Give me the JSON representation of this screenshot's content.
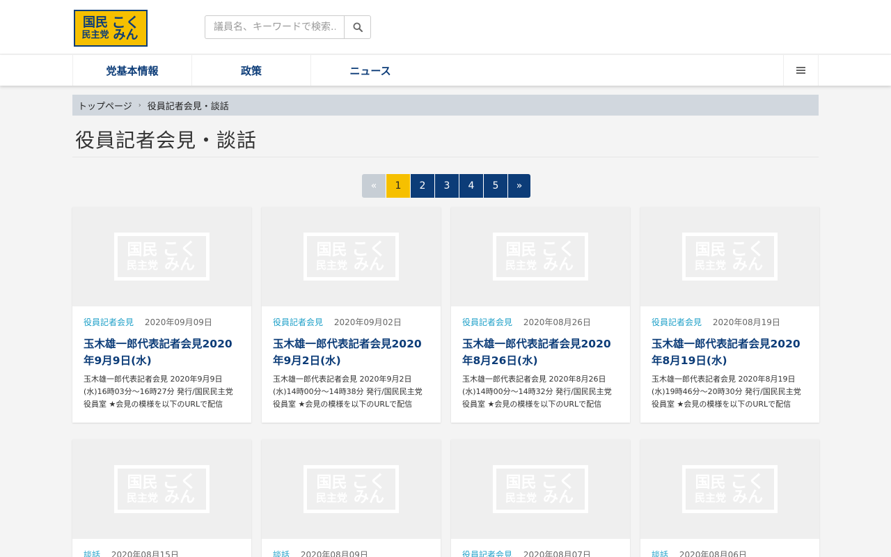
{
  "header": {
    "logo": {
      "kanji_top": "国民",
      "kanji_bottom": "民主党",
      "hira_top": "こく",
      "hira_bottom": "みん"
    },
    "search": {
      "placeholder": "議員名、キーワードで検索.."
    }
  },
  "nav": {
    "items": [
      {
        "label": "党基本情報"
      },
      {
        "label": "政策"
      },
      {
        "label": "ニュース"
      }
    ],
    "menu_icon": "hamburger-icon"
  },
  "breadcrumb": {
    "home": "トップページ",
    "separator": "›",
    "current": "役員記者会見・談話"
  },
  "page": {
    "title": "役員記者会見・談話"
  },
  "pagination": {
    "prev": "«",
    "pages": [
      "1",
      "2",
      "3",
      "4",
      "5"
    ],
    "active": "1",
    "next": "»"
  },
  "cards": [
    {
      "category": "役員記者会見",
      "date": "2020年09月09日",
      "title": "玉木雄一郎代表記者会見2020年9月9日(水)",
      "excerpt": "玉木雄一郎代表記者会見 2020年9月9日(水)16時03分〜16時27分 発行/国民民主党役員室 ★会見の模様を以下のURLで配信"
    },
    {
      "category": "役員記者会見",
      "date": "2020年09月02日",
      "title": "玉木雄一郎代表記者会見2020年9月2日(水)",
      "excerpt": "玉木雄一郎代表記者会見 2020年9月2日(水)14時00分〜14時38分 発行/国民民主党役員室 ★会見の模様を以下のURLで配信"
    },
    {
      "category": "役員記者会見",
      "date": "2020年08月26日",
      "title": "玉木雄一郎代表記者会見2020年8月26日(水)",
      "excerpt": "玉木雄一郎代表記者会見 2020年8月26日(水)14時00分〜14時32分 発行/国民民主党役員室 ★会見の模様を以下のURLで配信"
    },
    {
      "category": "役員記者会見",
      "date": "2020年08月19日",
      "title": "玉木雄一郎代表記者会見2020年8月19日(水)",
      "excerpt": "玉木雄一郎代表記者会見 2020年8月19日(水)19時46分〜20時30分 発行/国民民主党役員室 ★会見の模様を以下のURLで配信"
    },
    {
      "category": "談話",
      "date": "2020年08月15日"
    },
    {
      "category": "談話",
      "date": "2020年08月09日"
    },
    {
      "category": "役員記者会見",
      "date": "2020年08月07日"
    },
    {
      "category": "談話",
      "date": "2020年08月06日"
    }
  ],
  "colors": {
    "brand_navy": "#0c3c78",
    "brand_yellow": "#f6c000",
    "category_cyan": "#1ea0c8",
    "breadcrumb_bg": "#d1d7de"
  }
}
